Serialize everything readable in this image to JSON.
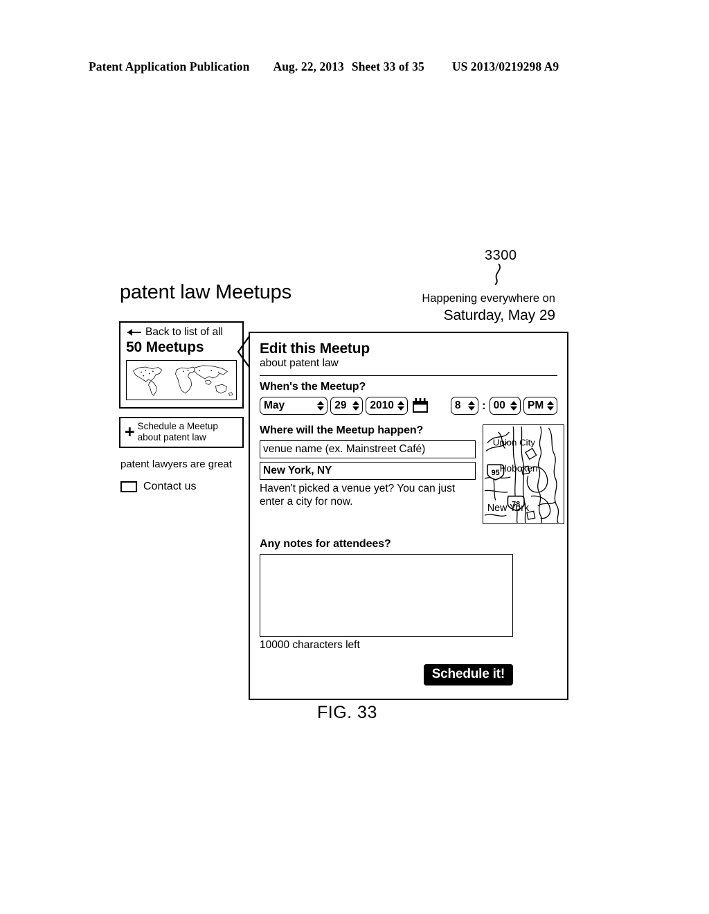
{
  "patent_header": {
    "publication": "Patent Application Publication",
    "date": "Aug. 22, 2013",
    "sheet": "Sheet 33 of 35",
    "number": "US 2013/0219298 A9"
  },
  "figure": {
    "reference_numeral": "3300",
    "caption": "FIG. 33"
  },
  "header": {
    "app_title": "patent law Meetups",
    "happening_line1": "Happening everywhere on",
    "happening_line2": "Saturday, May 29"
  },
  "sidebar": {
    "back_link": "Back to list of all",
    "meetup_count": "50 Meetups",
    "world_map_icon": "world-map-icon",
    "schedule_link": "Schedule a Meetup about patent law",
    "plus_icon": "plus-icon",
    "tagline": "patent lawyers are great",
    "contact_label": "Contact us",
    "contact_icon": "envelope-icon"
  },
  "panel": {
    "title": "Edit this Meetup",
    "subtitle": "about patent law",
    "when_label": "When's the Meetup?",
    "date_time": {
      "month": "May",
      "day": "29",
      "year": "2010",
      "calendar_icon": "calendar-icon",
      "hour": "8",
      "separator": ":",
      "minute": "00",
      "meridiem": "PM"
    },
    "where_label": "Where will the Meetup happen?",
    "venue_placeholder": "venue name (ex. Mainstreet Café)",
    "city_value": "New York, NY",
    "where_hint": "Haven't picked a venue yet?  You can just enter a city for now.",
    "map": {
      "icon": "location-map-icon",
      "labels": [
        "Union City",
        "Hoboken",
        "New York"
      ],
      "route_shields": [
        "95",
        "78"
      ]
    },
    "notes_label": "Any notes for attendees?",
    "notes_value": "",
    "characters_left": "10000 characters left",
    "submit_label": "Schedule it!"
  }
}
